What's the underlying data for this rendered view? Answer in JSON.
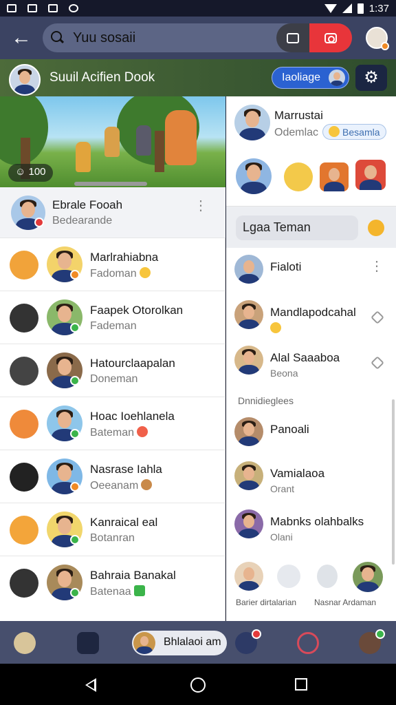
{
  "status_bar": {
    "time": "1:37"
  },
  "top_bar": {
    "search_text": "Yuu sosaii"
  },
  "group": {
    "title": "Suuil Acifien Dook",
    "tag_label": "Iaoliage",
    "banner_count": "100"
  },
  "pinned_chat": {
    "name": "Ebrale Fooah",
    "subtitle": "Bedearande"
  },
  "chats": [
    {
      "name": "Marlrahiabna",
      "subtitle": "Fadoman"
    },
    {
      "name": "Faapek Otorolkan",
      "subtitle": "Fademan"
    },
    {
      "name": "Hatourclaapalan",
      "subtitle": "Doneman"
    },
    {
      "name": "Hoac Ioehlanela",
      "subtitle": "Bateman"
    },
    {
      "name": "Nasrase Iahla",
      "subtitle": "Oeeanam"
    },
    {
      "name": "Kanraical eal",
      "subtitle": "Botanran"
    },
    {
      "name": "Bahraia Banakal",
      "subtitle": "Batenaa"
    }
  ],
  "right_panel": {
    "profile": {
      "name": "Marrustai",
      "subtitle": "Odemlac",
      "pill": "Besamla"
    },
    "search_label": "Lgaa Teman",
    "rows": [
      {
        "name": "Fialoti",
        "subtitle": ""
      },
      {
        "name": "Mandlapodcahal",
        "subtitle": ""
      },
      {
        "name": "Alal Saaaboa",
        "subtitle": "Beona"
      }
    ],
    "section_label": "Dnnidieglees",
    "section_rows": [
      {
        "name": "Panoali",
        "subtitle": ""
      },
      {
        "name": "Vamialaoa",
        "subtitle": "Orant"
      },
      {
        "name": "Mabnks olahbalks",
        "subtitle": "Olani"
      }
    ],
    "bottom_labels": [
      "Barier dirtalarian",
      "Nasnar Ardaman"
    ]
  },
  "tab_bar": {
    "pill_label": "Bhlalaoi am"
  },
  "colors": {
    "header": "#3b4362",
    "accent_red": "#e8353a",
    "tag_blue": "#2b62d1",
    "tab_bar": "#474f6d"
  }
}
